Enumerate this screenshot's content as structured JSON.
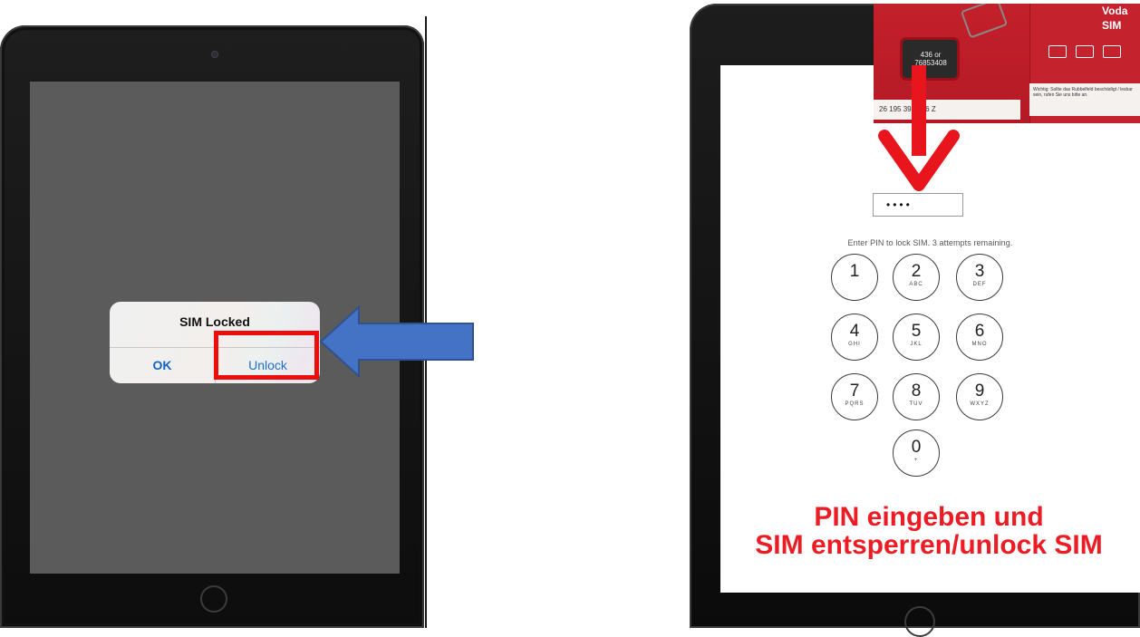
{
  "left_device": {
    "alert": {
      "title": "SIM Locked",
      "ok_label": "OK",
      "unlock_label": "Unlock"
    }
  },
  "right_device": {
    "pin_prompt": "Enter PIN to lock SIM. 3 attempts remaining.",
    "pin_value": "••••",
    "keypad": [
      {
        "digit": "1",
        "letters": ""
      },
      {
        "digit": "2",
        "letters": "ABC"
      },
      {
        "digit": "3",
        "letters": "DEF"
      },
      {
        "digit": "4",
        "letters": "GHI"
      },
      {
        "digit": "5",
        "letters": "JKL"
      },
      {
        "digit": "6",
        "letters": "MNO"
      },
      {
        "digit": "7",
        "letters": "PQRS"
      },
      {
        "digit": "8",
        "letters": "TUV"
      },
      {
        "digit": "9",
        "letters": "WXYZ"
      },
      {
        "digit": "0",
        "letters": "+"
      }
    ],
    "sim_card": {
      "brand": "Voda\nSIM",
      "chip_label": "436 or\n76853408",
      "number": "26 195 39486 6 Z",
      "info": "Wichtig: Sollte das Rubbelfeld beschädigt / lesbar sein, rufen Sie uns bitte an."
    }
  },
  "overlay": {
    "line1": "PIN eingeben und",
    "line2": "SIM entsperren/unlock SIM"
  },
  "colors": {
    "highlight_red": "#ee0d0d",
    "arrow_blue": "#4472c4",
    "arrow_red": "#e8161c",
    "ios_blue": "#1f70cc",
    "overlay_red": "#ec1c24"
  }
}
